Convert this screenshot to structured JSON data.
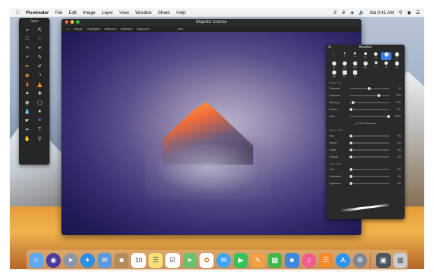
{
  "menubar": {
    "apple": "",
    "app": "Pixelmator",
    "items": [
      "File",
      "Edit",
      "Image",
      "Layer",
      "View",
      "Window",
      "Share",
      "Help"
    ],
    "clock": "Sat 9:41 AM"
  },
  "tools": {
    "title": "Tools"
  },
  "window": {
    "title": "Majestic Sunrise",
    "options": {
      "range_label": "Range:",
      "highlights": "Highlights",
      "midtones": "Midtones",
      "shadows": "Shadows",
      "exposure_label": "Exposure:",
      "exposure_value": "50%"
    }
  },
  "brushes": {
    "title": "Brushes",
    "sizes": [
      "1",
      "3",
      "5",
      "10",
      "15",
      "20",
      "30",
      "50",
      "100",
      "150",
      "200",
      "10",
      "20",
      "40",
      "100",
      "80",
      "60"
    ],
    "sections": {
      "shape_tip": "Shape Tip",
      "shape_jitter": "Shape Jitter",
      "color_jitter": "Color Jitter"
    },
    "controls": [
      {
        "label": "Diameter",
        "value": "50"
      },
      {
        "label": "Hardness",
        "value": "76%"
      },
      {
        "label": "Spacing",
        "value": "10%"
      },
      {
        "label": "Scatter",
        "value": "0%"
      },
      {
        "label": "Flow",
        "value": "100%"
      }
    ],
    "follow_direction": "Follow Direction",
    "jitter": [
      {
        "label": "Size",
        "value": "0%"
      },
      {
        "label": "Stroke",
        "value": "0%"
      },
      {
        "label": "Angle",
        "value": "0%"
      },
      {
        "label": "Opacity",
        "value": "0%"
      }
    ],
    "color": [
      {
        "label": "Hue",
        "value": "0%"
      },
      {
        "label": "Saturation",
        "value": "0%"
      },
      {
        "label": "Lightness",
        "value": "0%"
      }
    ]
  },
  "dock": {
    "icons": [
      "finder-icon",
      "siri-icon",
      "launchpad-icon",
      "safari-icon",
      "mail-icon",
      "contacts-icon",
      "calendar-icon",
      "notes-icon",
      "reminders-icon",
      "maps-icon",
      "photos-icon",
      "messages-icon",
      "facetime-icon",
      "pages-icon",
      "numbers-icon",
      "keynote-icon",
      "itunes-icon",
      "ibooks-icon",
      "appstore-icon",
      "preferences-icon",
      "pixelmator-icon",
      "downloads-icon",
      "trash-icon"
    ],
    "calendar_day": "10"
  }
}
